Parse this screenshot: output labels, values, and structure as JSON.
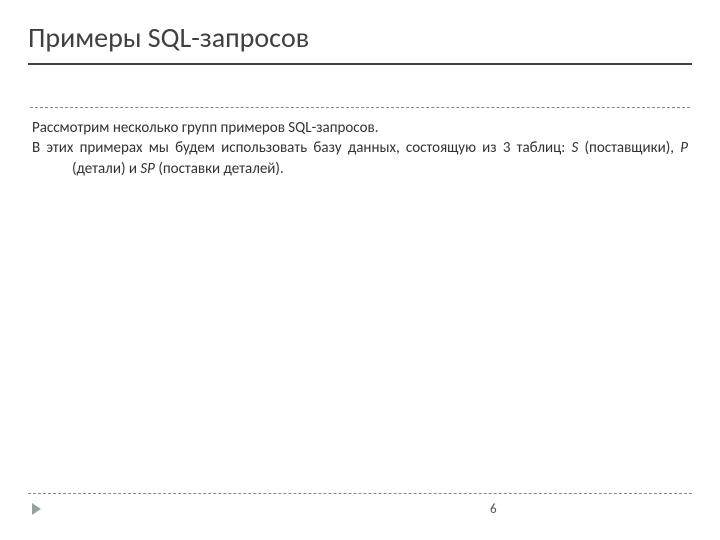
{
  "title": "Примеры SQL-запросов",
  "body": {
    "p1": "Рассмотрим несколько групп примеров SQL-запросов.",
    "p2_prefix": "В этих примерах мы будем использовать базу данных, состоящую из 3 таблиц: ",
    "t1": "S",
    "t1_desc": " (поставщики), ",
    "t2": "P",
    "t2_desc": " (детали)  и ",
    "t3": "SP",
    "t3_desc": " (поставки деталей)."
  },
  "page_number": "6"
}
